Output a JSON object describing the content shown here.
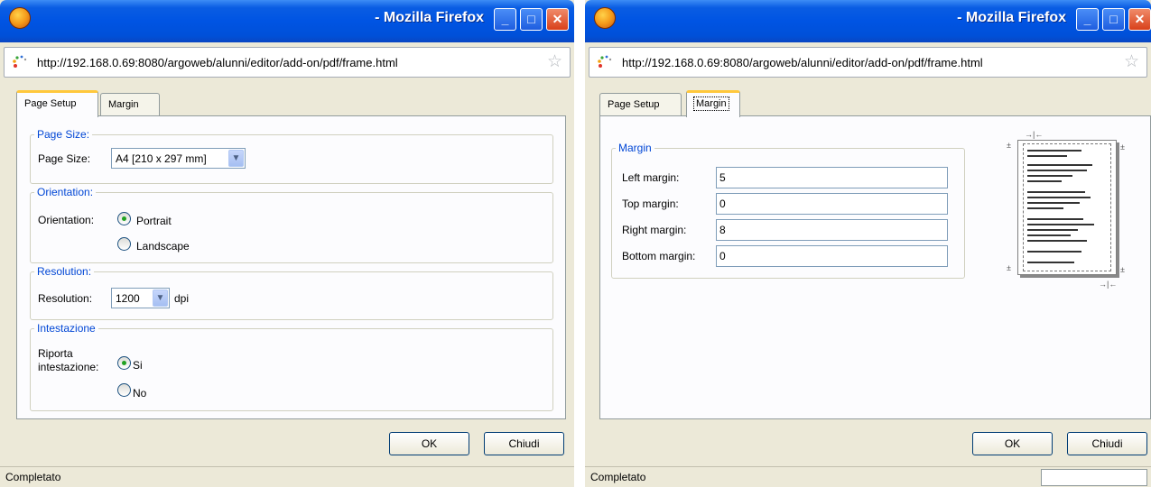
{
  "windows": [
    {
      "title": "- Mozilla Firefox",
      "url": "http://192.168.0.69:8080/argoweb/alunni/editor/add-on/pdf/frame.html",
      "tabs": [
        "Page Setup",
        "Margin"
      ],
      "active_tab": "Page Setup",
      "page_size": {
        "legend": "Page Size:",
        "label": "Page Size:",
        "value": "A4 [210 x 297 mm]"
      },
      "orientation": {
        "legend": "Orientation:",
        "label": "Orientation:",
        "options": [
          "Portrait",
          "Landscape"
        ],
        "selected": "Portrait"
      },
      "resolution": {
        "legend": "Resolution:",
        "label": "Resolution:",
        "value": "1200",
        "unit": "dpi"
      },
      "intestazione": {
        "legend": "Intestazione",
        "label": "Riporta intestazione:",
        "options": [
          "Si",
          "No"
        ],
        "selected": "Si"
      },
      "buttons": {
        "ok": "OK",
        "close": "Chiudi"
      },
      "status": "Completato"
    },
    {
      "title": "- Mozilla Firefox",
      "url": "http://192.168.0.69:8080/argoweb/alunni/editor/add-on/pdf/frame.html",
      "tabs": [
        "Page Setup",
        "Margin"
      ],
      "active_tab": "Margin",
      "margin": {
        "legend": "Margin",
        "fields": [
          {
            "label": "Left margin:",
            "value": "5"
          },
          {
            "label": "Top margin:",
            "value": "0"
          },
          {
            "label": "Right margin:",
            "value": "8"
          },
          {
            "label": "Bottom margin:",
            "value": "0"
          }
        ]
      },
      "buttons": {
        "ok": "OK",
        "close": "Chiudi"
      },
      "status": "Completato"
    }
  ],
  "colors": {
    "titlebar": "#0054e3",
    "legend_text": "#0046d5",
    "active_tab_accent": "#ffc83c",
    "radio_dot": "#21a121"
  },
  "icons": [
    "firefox-logo-icon",
    "page-loading-icon",
    "bookmark-star-icon",
    "minimize-icon",
    "maximize-icon",
    "close-icon",
    "dropdown-arrow-icon"
  ]
}
